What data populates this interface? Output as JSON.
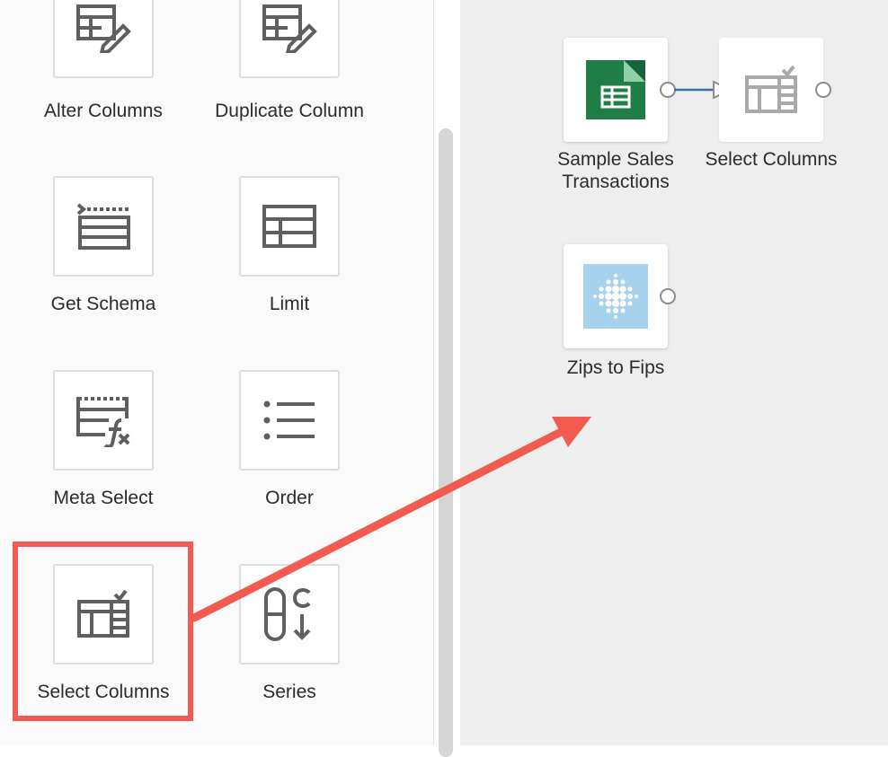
{
  "palette": {
    "tools": [
      {
        "id": "alter-columns",
        "label": "Alter Columns",
        "icon": "table-edit-icon"
      },
      {
        "id": "duplicate-column",
        "label": "Duplicate Column",
        "icon": "table-edit-icon"
      },
      {
        "id": "get-schema",
        "label": "Get Schema",
        "icon": "schema-icon"
      },
      {
        "id": "limit",
        "label": "Limit",
        "icon": "table-icon"
      },
      {
        "id": "meta-select",
        "label": "Meta Select",
        "icon": "table-function-icon"
      },
      {
        "id": "order",
        "label": "Order",
        "icon": "list-icon"
      },
      {
        "id": "select-columns",
        "label": "Select Columns",
        "icon": "select-columns-icon"
      },
      {
        "id": "series",
        "label": "Series",
        "icon": "series-icon"
      }
    ]
  },
  "canvas": {
    "nodes": [
      {
        "id": "sample-sales",
        "label_line1": "Sample Sales",
        "label_line2": "Transactions",
        "icon": "spreadsheet-icon"
      },
      {
        "id": "select-columns-node",
        "label": "Select Columns",
        "icon": "select-columns-icon"
      },
      {
        "id": "zips-to-fips",
        "label": "Zips to Fips",
        "icon": "dot-grid-icon"
      }
    ]
  },
  "colors": {
    "highlight": "#f25b50",
    "connector": "#3a6fa5",
    "icon_gray": "#5f5f5f",
    "sheets_green": "#1e7e45"
  }
}
